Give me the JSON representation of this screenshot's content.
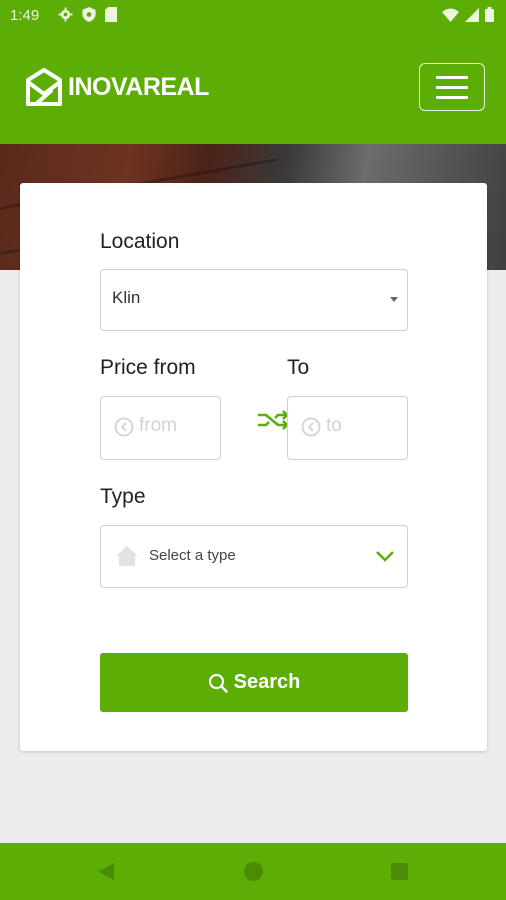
{
  "status_bar": {
    "time": "1:49",
    "icons_left": [
      "settings-icon",
      "shield-icon",
      "sd-card-icon"
    ],
    "icons_right": [
      "wifi-icon",
      "signal-icon",
      "battery-icon"
    ]
  },
  "header": {
    "logo_text": "INOVAREAL",
    "logo_icon": "house-logo-icon",
    "menu_icon": "hamburger-menu-icon"
  },
  "colors": {
    "brand_green": "#5cad05",
    "placeholder_gray": "#d2d2d2"
  },
  "search_form": {
    "location_label": "Location",
    "location_value": "Klin",
    "price_from_label": "Price from",
    "price_to_label": "To",
    "from_placeholder": "from",
    "to_placeholder": "to",
    "type_label": "Type",
    "type_placeholder": "Select a type",
    "search_label": "Search"
  },
  "nav_bar": {
    "buttons": [
      "back",
      "home",
      "recents"
    ]
  }
}
